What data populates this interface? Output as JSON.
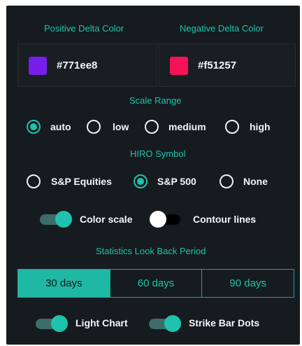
{
  "colors": {
    "accent": "#1fc2ae",
    "panel_bg": "#161b1f",
    "positive_swatch": "#771ee8",
    "negative_swatch": "#f51257"
  },
  "delta_colors": {
    "positive_label": "Positive Delta Color",
    "negative_label": "Negative Delta Color",
    "positive_value": "#771ee8",
    "negative_value": "#f51257"
  },
  "scale_range": {
    "label": "Scale Range",
    "options": [
      "auto",
      "low",
      "medium",
      "high"
    ],
    "selected": "auto"
  },
  "hiro_symbol": {
    "label": "HIRO Symbol",
    "options": [
      "S&P Equities",
      "S&P 500",
      "None"
    ],
    "selected": "S&P 500"
  },
  "toggles_row1": {
    "color_scale": {
      "label": "Color scale",
      "on": true
    },
    "contour_lines": {
      "label": "Contour lines",
      "on": false
    }
  },
  "lookback": {
    "label": "Statistics Look Back Period",
    "options": [
      "30 days",
      "60 days",
      "90 days"
    ],
    "selected": "30 days"
  },
  "toggles_row2": {
    "light_chart": {
      "label": "Light Chart",
      "on": true
    },
    "strike_bar_dots": {
      "label": "Strike Bar Dots",
      "on": true
    }
  }
}
